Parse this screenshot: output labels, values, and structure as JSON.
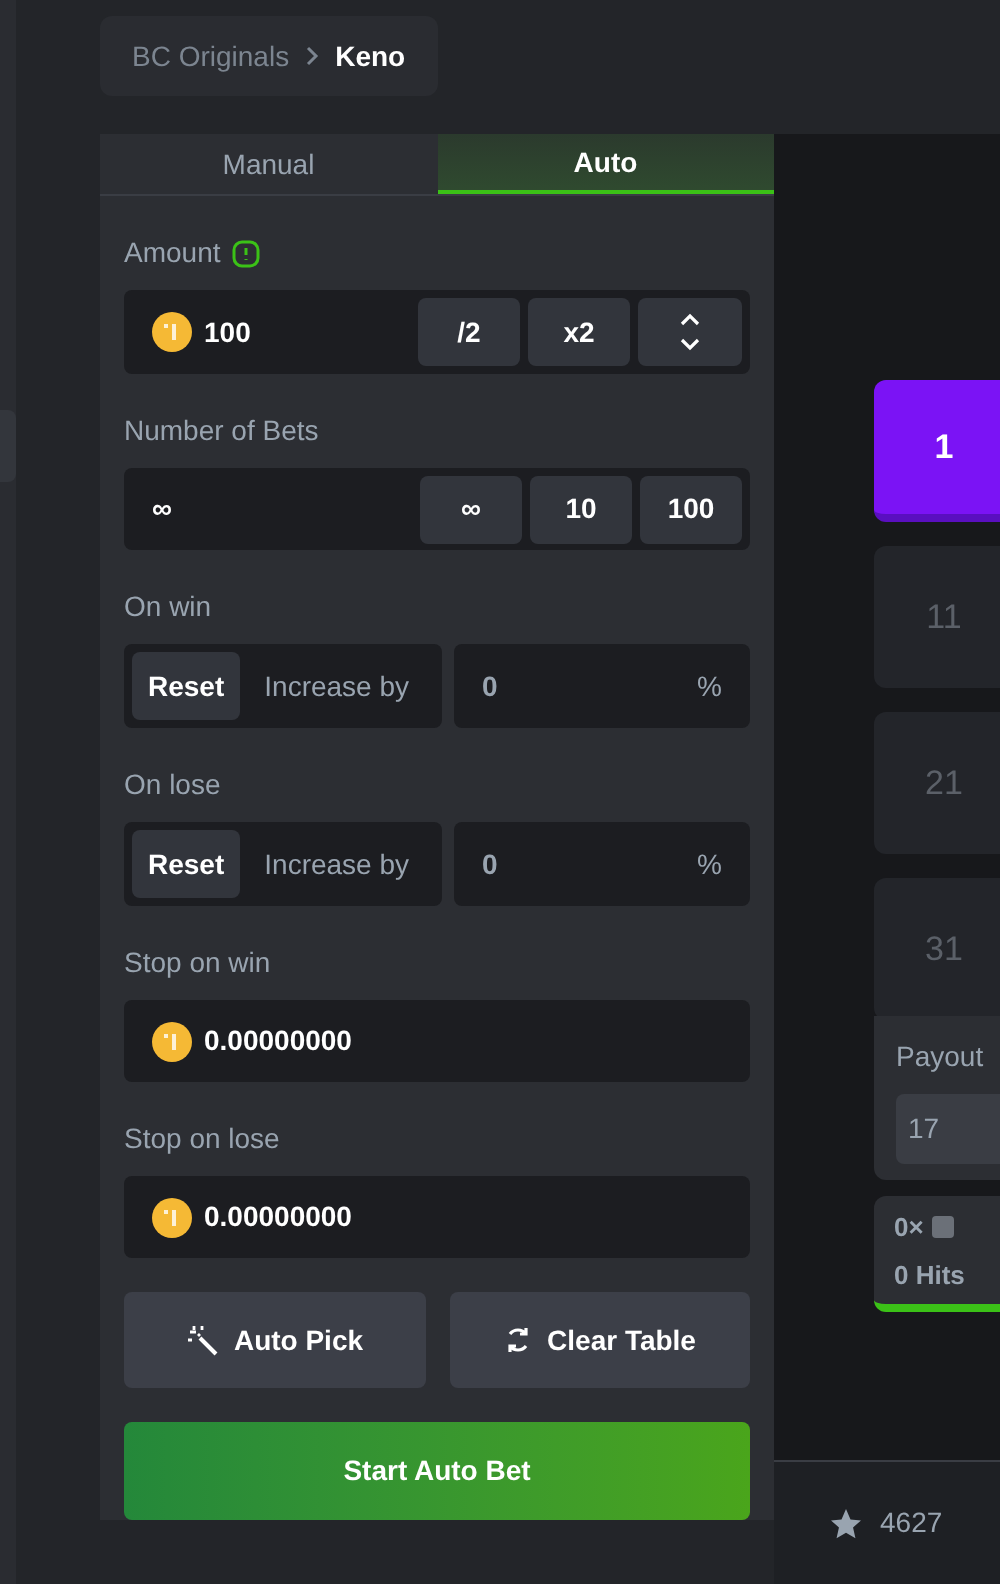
{
  "breadcrumb": {
    "parent": "BC Originals",
    "current": "Keno"
  },
  "tabs": [
    {
      "label": "Manual",
      "selected": false
    },
    {
      "label": "Auto",
      "selected": true
    }
  ],
  "amount": {
    "label": "Amount",
    "value": "100",
    "buttons": [
      "/2",
      "x2"
    ]
  },
  "number_of_bets": {
    "label": "Number of Bets",
    "value": "∞",
    "buttons": [
      "∞",
      "10",
      "100"
    ]
  },
  "on_win": {
    "label": "On win",
    "reset": "Reset",
    "mode": "Increase by",
    "value": "0",
    "unit": "%"
  },
  "on_lose": {
    "label": "On lose",
    "reset": "Reset",
    "mode": "Increase by",
    "value": "0",
    "unit": "%"
  },
  "stop_on_win": {
    "label": "Stop on win",
    "value": "0.00000000"
  },
  "stop_on_lose": {
    "label": "Stop on lose",
    "value": "0.00000000"
  },
  "actions": [
    {
      "kind": "auto_pick",
      "label": "Auto Pick"
    },
    {
      "kind": "clear",
      "label": "Clear Table"
    }
  ],
  "start_button": "Start Auto Bet",
  "game": {
    "tiles": [
      {
        "label": "1",
        "selected": true
      },
      {
        "label": "11",
        "selected": false
      },
      {
        "label": "21",
        "selected": false
      },
      {
        "label": "31",
        "selected": false
      }
    ],
    "payout": {
      "label": "Payout",
      "value": "17"
    },
    "multiplier": "0×",
    "hits": "0 Hits"
  },
  "footer": {
    "likes": "4627"
  }
}
